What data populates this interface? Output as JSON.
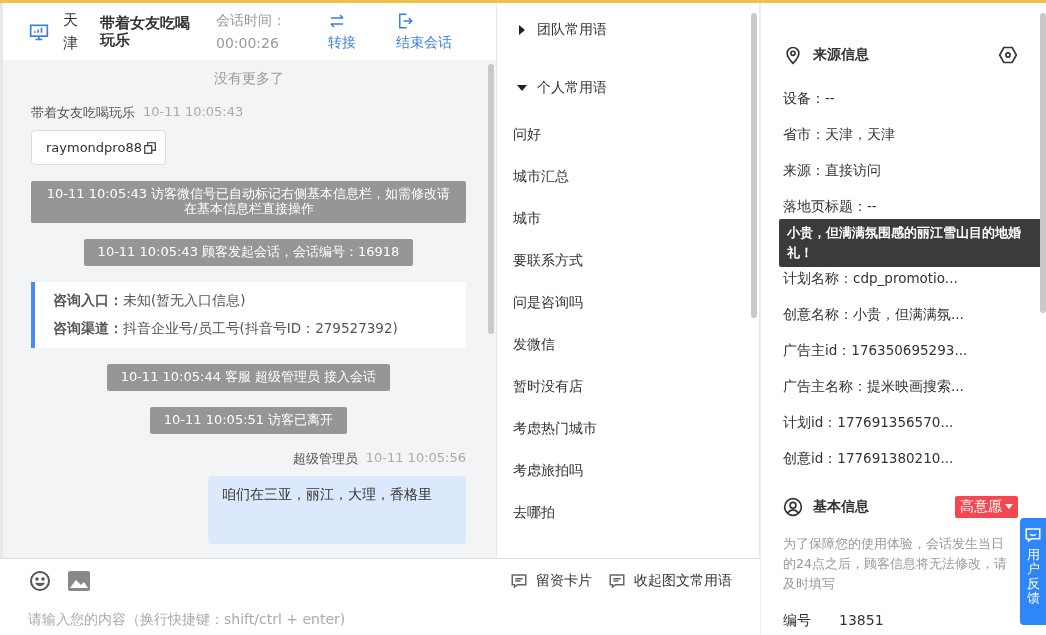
{
  "header": {
    "city": "天津",
    "name": "带着女友吃喝玩乐",
    "time_label": "会话时间：",
    "time": "00:00:26",
    "actions": [
      {
        "label": "转接",
        "kind": "transfer"
      },
      {
        "label": "结束会话",
        "kind": "end"
      }
    ]
  },
  "chat": {
    "no_more": "没有更多了",
    "messages": [
      {
        "kind": "visitor",
        "sender": "带着女友吃喝玩乐",
        "time": "10-11 10:05:43",
        "text": "raymondpro88"
      },
      {
        "kind": "system",
        "text": "10-11 10:05:43 访客微信号已自动标记右侧基本信息栏，如需修改请在基本信息栏直接操作"
      },
      {
        "kind": "system",
        "text": "10-11 10:05:43 顾客发起会话，会话编号：16918"
      },
      {
        "kind": "info",
        "rows": [
          {
            "label": "咨询入口：",
            "value": "未知(暂无入口信息)"
          },
          {
            "label": "咨询渠道：",
            "value": "抖音企业号/员工号(抖音号ID：279527392)"
          }
        ]
      },
      {
        "kind": "system",
        "text": "10-11 10:05:44 客服 超级管理员 接入会话"
      },
      {
        "kind": "system",
        "text": "10-11 10:05:51 访客已离开"
      },
      {
        "kind": "agent",
        "sender": "超级管理员",
        "time": "10-11 10:05:56",
        "text": "咱们在三亚，丽江，大理，香格里"
      }
    ]
  },
  "phrases": {
    "groups": [
      {
        "label": "团队常用语",
        "expanded": false
      },
      {
        "label": "个人常用语",
        "expanded": true,
        "items": [
          "问好",
          "城市汇总",
          "城市",
          "要联系方式",
          "问是咨询吗",
          "发微信",
          "暂时没有店",
          "考虑热门城市",
          "考虑旅拍吗",
          "去哪拍"
        ]
      }
    ]
  },
  "composer": {
    "tools": [
      "留资卡片",
      "收起图文常用语"
    ],
    "placeholder": "请输入您的内容（换行快捷键：shift/ctrl + enter)"
  },
  "source_info": {
    "title": "来源信息",
    "rows": [
      "设备：--",
      "省市：天津，天津",
      "来源：直接访问",
      "落地页标题：--",
      "计划名称：cdp_promotio...",
      "创意名称：小贵，但满满氛...",
      "广告主id：176350695293...",
      "广告主名称：提米映画搜索...",
      "计划id：177691356570...",
      "创意id：177691380210..."
    ]
  },
  "tooltip": "小贵，但满满氛围感的丽江雪山目的地婚礼！",
  "basic_info": {
    "title": "基本信息",
    "intent": "高意愿",
    "notice": "为了保障您的使用体验，会话发生当日的24点之后，顾客信息将无法修改，请及时填写",
    "fields": [
      {
        "label": "编号",
        "value": "13851"
      }
    ]
  },
  "feedback": "用户反馈"
}
